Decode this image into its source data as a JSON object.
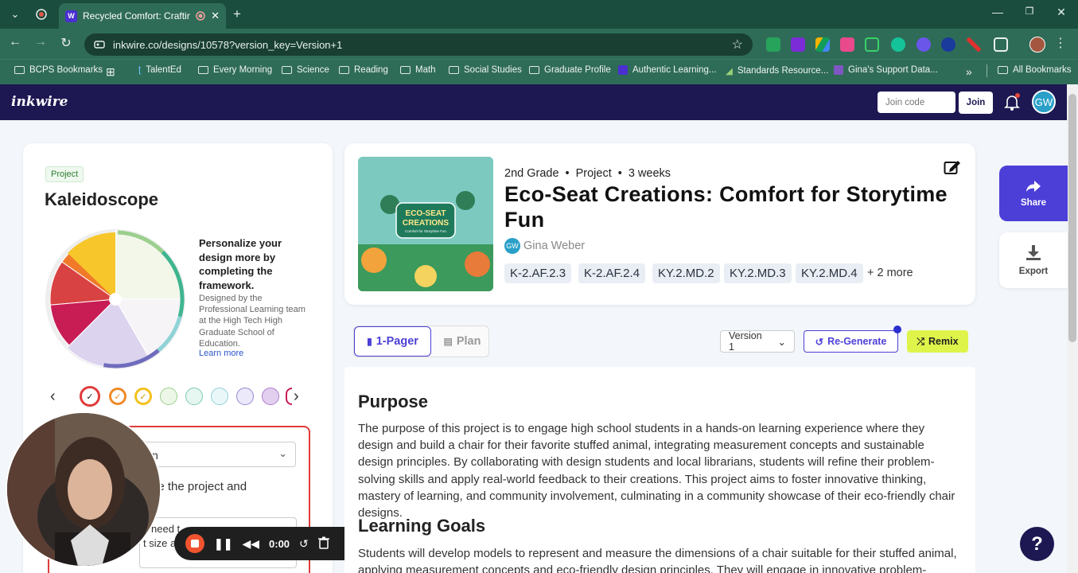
{
  "browser": {
    "tab_title": "Recycled Comfort: Crafting",
    "url": "inkwire.co/designs/10578?version_key=Version+1",
    "bookmarks": [
      "BCPS Bookmarks",
      "TalentEd",
      "Every Morning",
      "Science",
      "Reading",
      "Math",
      "Social Studies",
      "Graduate Profile",
      "Authentic Learning...",
      "Standards Resource...",
      "Gina's Support Data..."
    ],
    "all_bookmarks": "All Bookmarks",
    "more_chevron": "»"
  },
  "app": {
    "logo": "inkwire",
    "join_placeholder": "Join code",
    "join_label": "Join",
    "avatar_initials": "GW"
  },
  "framework": {
    "tag": "Project",
    "title": "Kaleidoscope",
    "personalize": "Personalize your design more by completing the framework.",
    "designed_by": "Designed by the Professional Learning team at the High Tech High Graduate School of Education.",
    "learn_more": "Learn more",
    "select_partial": "n",
    "guide_partial": "guide the project and",
    "need_partial": "need t",
    "size_partial": "t size an",
    "colors": {
      "wheel": [
        "#cfe8b8",
        "#a6dcc6",
        "#4db89a",
        "#3fa88a",
        "#a7a2d8",
        "#6f6bbd",
        "#d5b3e6",
        "#e0c6ee",
        "#c81c54",
        "#d94242",
        "#f07a2a",
        "#f4b91e",
        "#f6d22a"
      ]
    }
  },
  "recorder": {
    "time": "0:00"
  },
  "project": {
    "grade": "2nd Grade",
    "type": "Project",
    "duration": "3 weeks",
    "title": "Eco-Seat Creations: Comfort for Storytime Fun",
    "author_initials": "GW",
    "author": "Gina Weber",
    "standards": [
      "K-2.AF.2.3",
      "K-2.AF.2.4",
      "KY.2.MD.2",
      "KY.2.MD.3",
      "KY.2.MD.4"
    ],
    "more_standards": "+ 2 more",
    "thumb_text": "ECO-SEAT CREATIONS",
    "thumb_sub": "Comfort for Storytime Fun"
  },
  "actions": {
    "share": "Share",
    "export": "Export",
    "tab_onepager": "1-Pager",
    "tab_plan": "Plan",
    "version": "Version 1",
    "regenerate": "Re-Generate",
    "remix": "Remix"
  },
  "content": {
    "purpose_heading": "Purpose",
    "purpose_text": "The purpose of this project is to engage high school students in a hands-on learning experience where they design and build a chair for their favorite stuffed animal, integrating measurement concepts and sustainable design principles. By collaborating with design students and local librarians, students will refine their problem-solving skills and apply real-world feedback to their creations. This project aims to foster innovative thinking, mastery of learning, and community involvement, culminating in a community showcase of their eco-friendly chair designs.",
    "goals_heading": "Learning Goals",
    "goals_text": "Students will develop models to represent and measure the dimensions of a chair suitable for their stuffed animal, applying measurement concepts and eco-friendly design principles. They will engage in innovative problem-solving"
  }
}
